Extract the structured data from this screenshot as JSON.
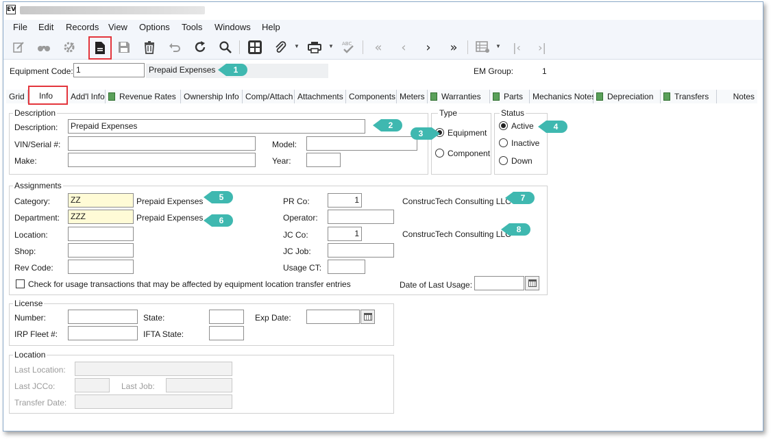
{
  "window": {
    "icon_glyph": "EV"
  },
  "menu": [
    "File",
    "Edit",
    "Records",
    "View",
    "Options",
    "Tools",
    "Windows",
    "Help"
  ],
  "toolbar": {
    "icons": [
      "edit-icon",
      "binoculars-icon",
      "gear-check-icon",
      "new-record-icon",
      "save-icon",
      "delete-icon",
      "undo-icon",
      "refresh-icon",
      "search-icon",
      "grid-icon",
      "attachment-icon",
      "print-icon",
      "spellcheck-icon",
      "first-record-icon",
      "previous-record-icon",
      "next-record-icon",
      "last-record-icon",
      "table-icon",
      "first-page-icon",
      "last-page-icon"
    ],
    "highlight_color": "#e3343b"
  },
  "header": {
    "equipment_code_label": "Equipment Code:",
    "equipment_code_value": "1",
    "equipment_description": "Prepaid Expenses",
    "em_group_label": "EM Group:",
    "em_group_value": "1"
  },
  "tabs": [
    "Grid",
    "Info",
    "Add'l Info",
    "Revenue Rates",
    "Ownership Info",
    "Comp/Attach",
    "Attachments",
    "Components",
    "Meters",
    "Warranties",
    "Parts",
    "Mechanics Notes",
    "Depreciation",
    "Transfers",
    "Notes"
  ],
  "description_group": {
    "title": "Description",
    "description_label": "Description:",
    "description_value": "Prepaid Expenses",
    "vin_label": "VIN/Serial #:",
    "vin_value": "",
    "model_label": "Model:",
    "model_value": "",
    "make_label": "Make:",
    "make_value": "",
    "year_label": "Year:",
    "year_value": ""
  },
  "type_group": {
    "title": "Type",
    "options": [
      "Equipment",
      "Component"
    ],
    "selected": "Equipment"
  },
  "status_group": {
    "title": "Status",
    "options": [
      "Active",
      "Inactive",
      "Down"
    ],
    "selected": "Active"
  },
  "assignments": {
    "title": "Assignments",
    "category_label": "Category:",
    "category_value": "ZZ",
    "category_desc": "Prepaid Expenses",
    "department_label": "Department:",
    "department_value": "ZZZ",
    "department_desc": "Prepaid Expenses",
    "location_label": "Location:",
    "location_value": "",
    "shop_label": "Shop:",
    "shop_value": "",
    "rev_code_label": "Rev Code:",
    "rev_code_value": "",
    "pr_co_label": "PR Co:",
    "pr_co_value": "1",
    "pr_co_name": "ConstrucTech Consulting LLC",
    "operator_label": "Operator:",
    "operator_value": "",
    "jc_co_label": "JC Co:",
    "jc_co_value": "1",
    "jc_co_name": "ConstrucTech Consulting LLC",
    "jc_job_label": "JC Job:",
    "jc_job_value": "",
    "usage_ct_label": "Usage CT:",
    "usage_ct_value": "",
    "check_usage_label": "Check for usage transactions that may be affected by equipment location transfer entries",
    "check_usage_checked": false,
    "last_usage_label": "Date of Last Usage:",
    "last_usage_value": ""
  },
  "license": {
    "title": "License",
    "number_label": "Number:",
    "number_value": "",
    "state_label": "State:",
    "state_value": "",
    "exp_date_label": "Exp Date:",
    "exp_date_value": "",
    "irp_fleet_label": "IRP Fleet #:",
    "irp_fleet_value": "",
    "ifta_state_label": "IFTA State:",
    "ifta_state_value": ""
  },
  "location_group": {
    "title": "Location",
    "last_location_label": "Last Location:",
    "last_jcco_label": "Last JCCo:",
    "last_job_label": "Last Job:",
    "transfer_date_label": "Transfer Date:"
  },
  "callouts": [
    "1",
    "2",
    "3",
    "4",
    "5",
    "6",
    "7",
    "8"
  ],
  "callout_color": "#3fb8b0"
}
